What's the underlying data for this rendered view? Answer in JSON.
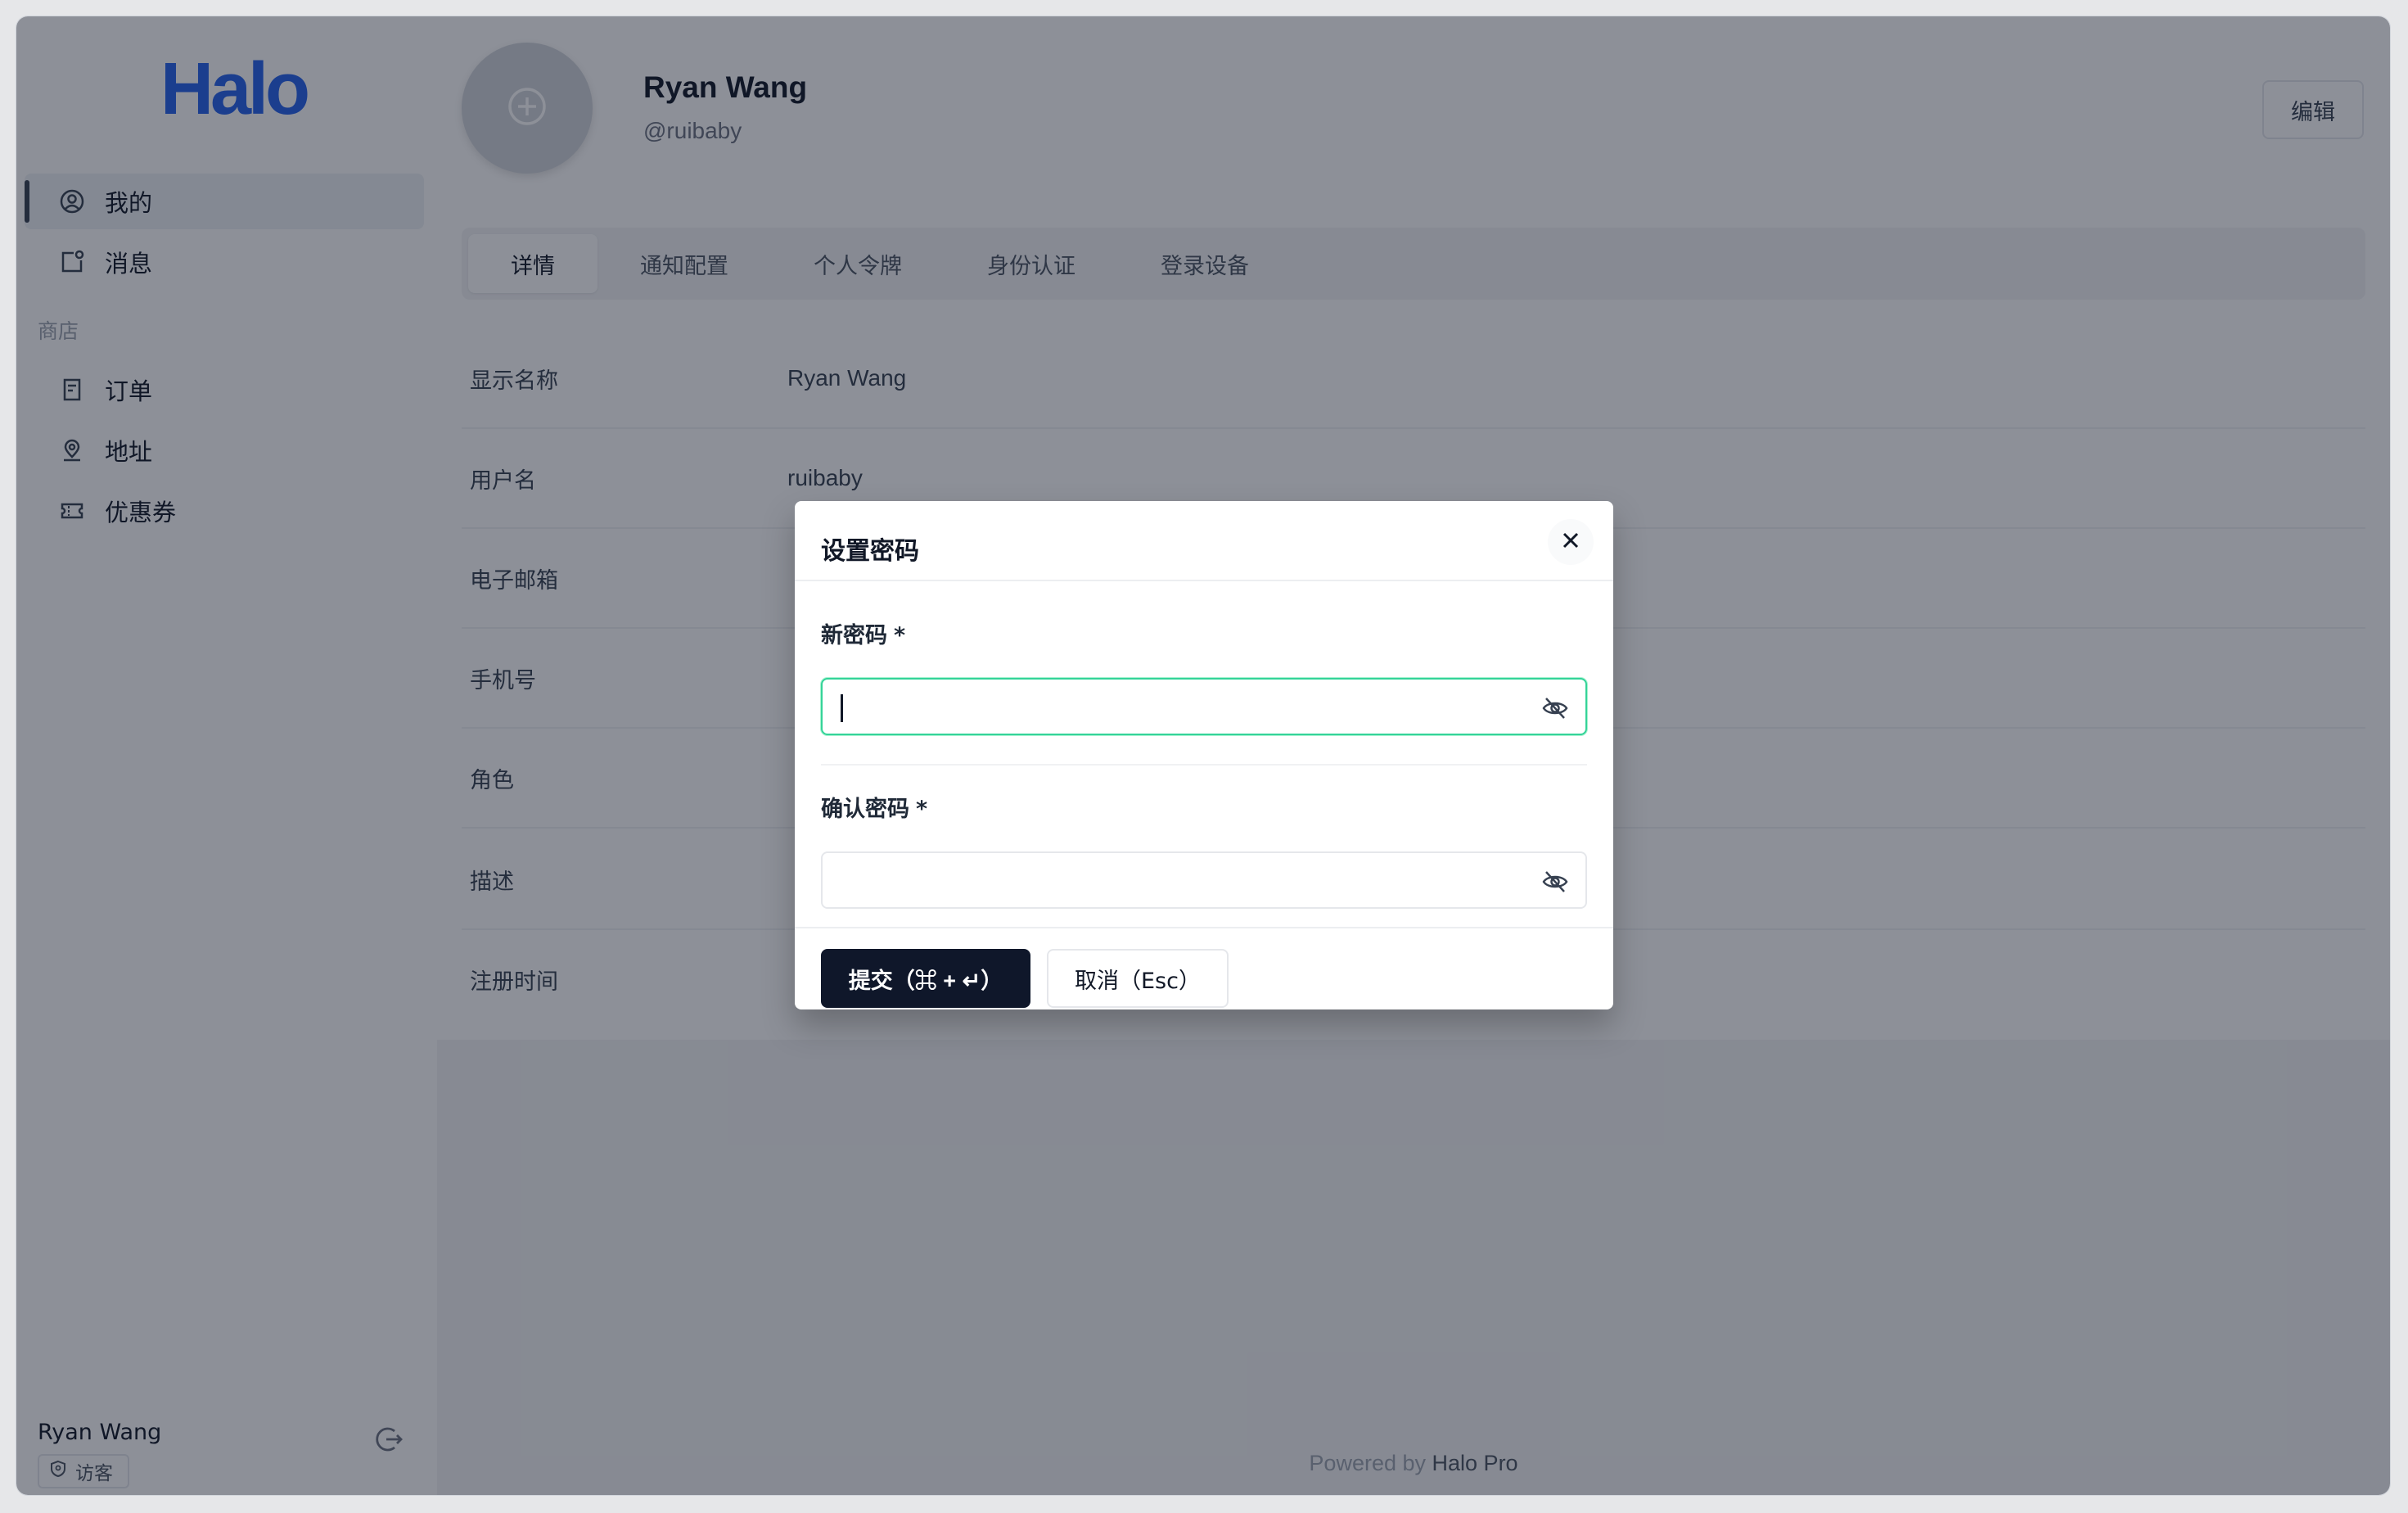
{
  "sidebar": {
    "logo": "Halo",
    "items": [
      {
        "label": "我的",
        "icon": "user-circle-icon"
      },
      {
        "label": "消息",
        "icon": "message-icon"
      }
    ],
    "section_label": "商店",
    "shop_items": [
      {
        "label": "订单",
        "icon": "receipt-icon"
      },
      {
        "label": "地址",
        "icon": "location-icon"
      },
      {
        "label": "优惠券",
        "icon": "coupon-icon"
      }
    ],
    "user_name": "Ryan Wang",
    "user_role": "访客"
  },
  "profile": {
    "display_name": "Ryan Wang",
    "handle": "@ruibaby",
    "edit_label": "编辑"
  },
  "tabs": [
    "详情",
    "通知配置",
    "个人令牌",
    "身份认证",
    "登录设备"
  ],
  "details": [
    {
      "label": "显示名称",
      "value": "Ryan Wang"
    },
    {
      "label": "用户名",
      "value": "ruibaby"
    },
    {
      "label": "电子邮箱",
      "value": ""
    },
    {
      "label": "手机号",
      "value": ""
    },
    {
      "label": "角色",
      "value": ""
    },
    {
      "label": "描述",
      "value": ""
    },
    {
      "label": "注册时间",
      "value": ""
    }
  ],
  "footer": {
    "prefix": "Powered by",
    "brand": "Halo Pro"
  },
  "modal": {
    "title": "设置密码",
    "new_password_label": "新密码",
    "confirm_password_label": "确认密码",
    "required_mark": "*",
    "new_password_value": "",
    "confirm_password_value": "",
    "submit_label": "提交（⌘ + ↵）",
    "cancel_label": "取消（Esc）"
  },
  "colors": {
    "accent": "#2563eb",
    "primary_button": "#0f172a",
    "focus": "#34d399"
  }
}
